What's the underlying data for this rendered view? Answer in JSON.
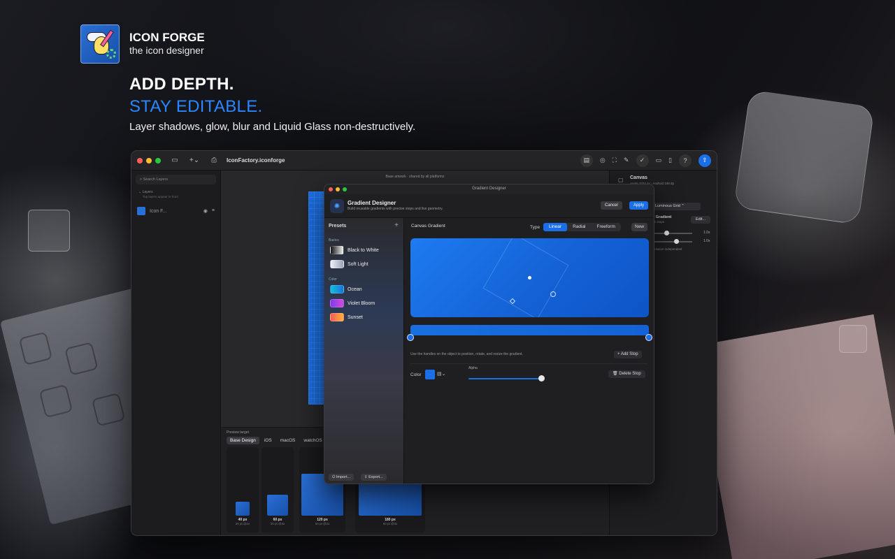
{
  "brand": {
    "title": "ICON FORGE",
    "subtitle": "the icon designer"
  },
  "headline": {
    "line1": "ADD DEPTH.",
    "line2": "STAY EDITABLE.",
    "tagline": "Layer shadows, glow, blur and Liquid Glass non-destructively.",
    "accent_color": "#2b86ff"
  },
  "window": {
    "document_title": "IconFactory.iconforge",
    "sidebar": {
      "search_placeholder": "Search Layers",
      "layers_header": "Layers",
      "layers_hint": "Top layers appear in front",
      "layer_name": "Icon F..."
    },
    "canvas_note": "Base artwork · shared by all platforms",
    "preview": {
      "label": "Preview target",
      "tabs": [
        "Base Design",
        "iOS",
        "macOS",
        "watchOS"
      ],
      "active_tab": "Base Design",
      "cards": [
        {
          "size": "40 px",
          "sub": "20 pt @2x"
        },
        {
          "size": "60 px",
          "sub": "20 pt @3x"
        },
        {
          "size": "120 px",
          "sub": "60 pt @2x"
        },
        {
          "size": "180 px",
          "sub": "60 pt @3x"
        }
      ]
    },
    "inspector": {
      "title": "Canvas",
      "subtitle": "Apple 1024 px · Android 108 dp",
      "grid_select": "Luminous Grid",
      "gradient_label": "ss Gradient",
      "gradient_sub": "r · 2 stops",
      "edit_button": "Edit...",
      "slider1_value": "1.0x",
      "slider2_value": "1.0x",
      "resolution_note": "resolution independent"
    }
  },
  "dialog": {
    "window_title": "Gradient Designer",
    "title": "Gradient Designer",
    "subtitle": "Build reusable gradients with precise stops and live geometry.",
    "cancel": "Cancel",
    "apply": "Apply",
    "presets": {
      "header": "Presets",
      "add": "+",
      "sections": [
        {
          "name": "Basics",
          "items": [
            {
              "label": "Black to White",
              "from": "#111111",
              "to": "#f2f2f2"
            },
            {
              "label": "Soft Light",
              "from": "#eef1f8",
              "to": "#9aa3b8"
            }
          ]
        },
        {
          "name": "Color",
          "items": [
            {
              "label": "Ocean",
              "from": "#12c2d6",
              "to": "#1b6fe0"
            },
            {
              "label": "Violet Bloom",
              "from": "#7a3cf0",
              "to": "#d44ad8"
            },
            {
              "label": "Sunset",
              "from": "#ff5a5a",
              "to": "#ffb13b"
            }
          ]
        }
      ],
      "import": "Import...",
      "export": "Export..."
    },
    "editor": {
      "gradient_name": "Canvas Gradient",
      "type_label": "Type",
      "types": [
        "Linear",
        "Radial",
        "Freeform"
      ],
      "active_type": "Linear",
      "new_button": "New",
      "hint": "Use the handles on the object to position, rotate, and resize the gradient.",
      "add_stop": "Add Stop",
      "color_label": "Color",
      "stop_color": "#1a6fe8",
      "alpha_label": "Alpha",
      "alpha_value": 1.0,
      "delete_stop": "Delete Stop"
    }
  }
}
